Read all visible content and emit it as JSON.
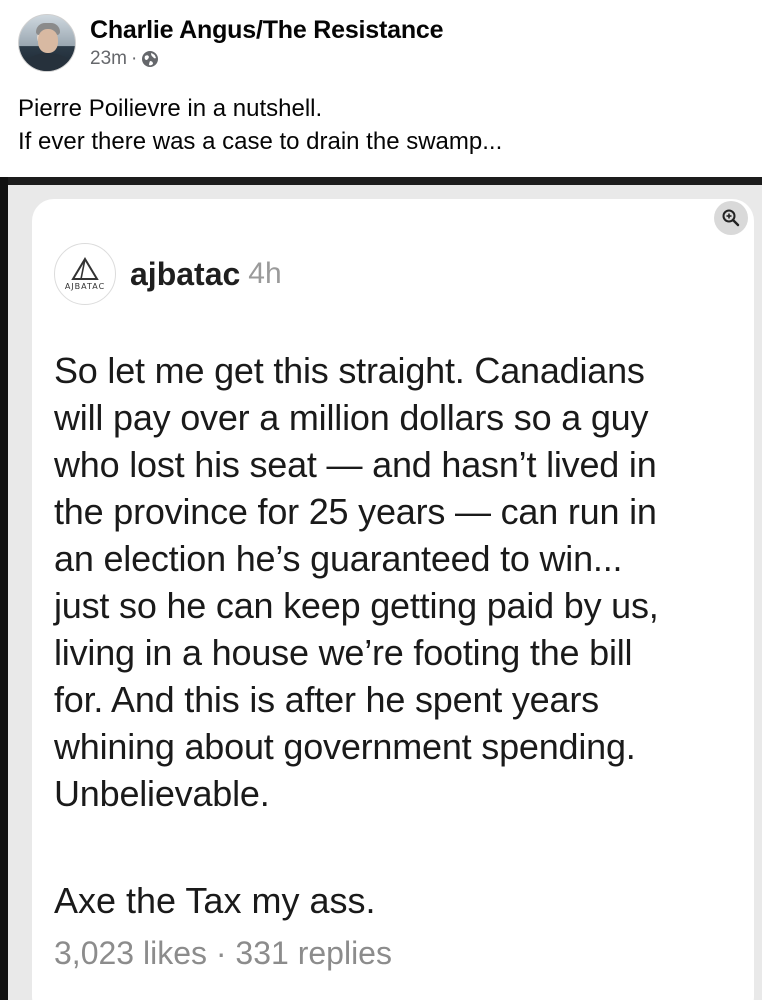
{
  "post": {
    "author": "Charlie Angus/The Resistance",
    "time": "23m",
    "separator": "·",
    "privacy_icon": "globe-icon",
    "caption_lines": [
      "Pierre Poilievre in a nutshell.",
      "If ever there was a case to drain the swamp..."
    ]
  },
  "embedded": {
    "zoom_icon": "zoom-in-icon",
    "logo_text": "AJBATAC",
    "handle": "ajbatac",
    "time": "4h",
    "body_lines": [
      "So let me get this straight. Canadians",
      "will pay over a million dollars so a guy",
      "who lost his seat — and hasn’t lived in",
      "the province for 25 years — can run in",
      "an election he’s guaranteed to win...",
      "just so he can keep getting paid by us,",
      "living in a house we’re footing the bill",
      "for. And this is after he spent years",
      "whining about government spending.",
      "Unbelievable."
    ],
    "tagline": "Axe the Tax my ass.",
    "stats": "3,023 likes · 331 replies"
  },
  "colors": {
    "text": "#050505",
    "muted": "#65676b",
    "card_bg": "#ffffff",
    "frame_bg": "#e9e9e9"
  }
}
